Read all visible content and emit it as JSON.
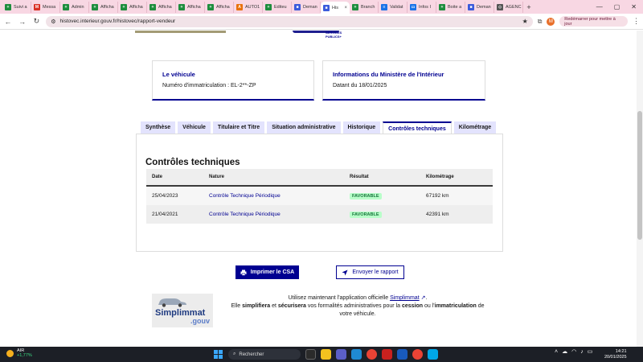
{
  "browser": {
    "tabs": [
      {
        "label": "Suivi a",
        "color": "#1e8e3e",
        "glyph": "+"
      },
      {
        "label": "Messa",
        "color": "#d93025",
        "glyph": "M"
      },
      {
        "label": "Admin",
        "color": "#1e8e3e",
        "glyph": "+"
      },
      {
        "label": "Afficha",
        "color": "#1e8e3e",
        "glyph": "+"
      },
      {
        "label": "Afficha",
        "color": "#1e8e3e",
        "glyph": "+"
      },
      {
        "label": "Afficha",
        "color": "#1e8e3e",
        "glyph": "+"
      },
      {
        "label": "Afficha",
        "color": "#1e8e3e",
        "glyph": "+"
      },
      {
        "label": "Afficha",
        "color": "#1e8e3e",
        "glyph": "+"
      },
      {
        "label": "AUTO1",
        "color": "#e8710a",
        "glyph": "A"
      },
      {
        "label": "Editeu",
        "color": "#1e8e3e",
        "glyph": "+"
      },
      {
        "label": "Deman",
        "color": "#3b5bdb",
        "glyph": "■"
      },
      {
        "label": "His",
        "color": "#3b5bdb",
        "glyph": "■",
        "active": true
      },
      {
        "label": "Branch",
        "color": "#1e8e3e",
        "glyph": "+"
      },
      {
        "label": "Validat",
        "color": "#1a73e8",
        "glyph": "≡"
      },
      {
        "label": "Infos I",
        "color": "#1a73e8",
        "glyph": "▭"
      },
      {
        "label": "Boite a",
        "color": "#1e8e3e",
        "glyph": "+"
      },
      {
        "label": "Deman",
        "color": "#3b5bdb",
        "glyph": "■"
      },
      {
        "label": "AGENC",
        "color": "#555555",
        "glyph": "◇"
      }
    ],
    "url": "histovec.interieur.gouv.fr/histovec/rapport-vendeur",
    "profile_initial": "M",
    "restart_label": "Redémarrer pour mettre à jour"
  },
  "header_logo": {
    "line1": "SERVICES",
    "line2": "PUBLICS+"
  },
  "cards": {
    "vehicle": {
      "title": "Le véhicule",
      "text": "Numéro d'immatriculation : EL-2**-ZP"
    },
    "ministry": {
      "title": "Informations du Ministère de l'Intérieur",
      "text": "Datant du 18/01/2025"
    }
  },
  "page_tabs": [
    {
      "label": "Synthèse"
    },
    {
      "label": "Véhicule"
    },
    {
      "label": "Titulaire et Titre"
    },
    {
      "label": "Situation administrative"
    },
    {
      "label": "Historique"
    },
    {
      "label": "Contrôles techniques",
      "active": true
    },
    {
      "label": "Kilométrage"
    }
  ],
  "controls": {
    "heading": "Contrôles techniques",
    "columns": [
      "Date",
      "Nature",
      "Résultat",
      "Kilométrage"
    ],
    "rows": [
      {
        "date": "25/04/2023",
        "nature": "Contrôle Technique Périodique",
        "result": "FAVORABLE",
        "km": "67192 km"
      },
      {
        "date": "21/04/2021",
        "nature": "Contrôle Technique Périodique",
        "result": "FAVORABLE",
        "km": "42391 km"
      }
    ]
  },
  "actions": {
    "print_label": "Imprimer le CSA",
    "send_label": "Envoyer le rapport"
  },
  "simplimmat": {
    "logo_word1": "Simplimmat",
    "logo_word2": ".gouv",
    "line1_prefix": "Utilisez maintenant l'application officielle",
    "line1_link": "Simplimmat",
    "line2_p1": "Elle",
    "line2_b1": "simplifiera",
    "line2_p2": "et",
    "line2_b2": "sécurisera",
    "line2_p3": "vos formalités administratives pour la",
    "line2_b3": "cession",
    "line2_p4": "ou l'",
    "line2_b4": "immatriculation",
    "line2_p5": "de votre véhicule."
  },
  "taskbar": {
    "weather_index": "AIR",
    "weather_change": "+1,77%",
    "search_placeholder": "Rechercher",
    "time": "14:21",
    "date": "20/01/2025"
  }
}
